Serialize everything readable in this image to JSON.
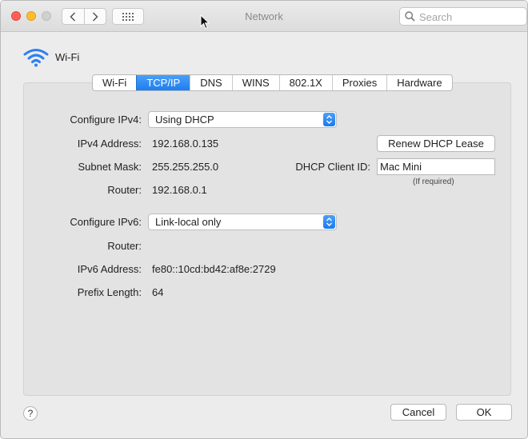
{
  "window": {
    "title": "Network"
  },
  "search": {
    "placeholder": "Search"
  },
  "header": {
    "interface_name": "Wi-Fi"
  },
  "tabs": [
    {
      "label": "Wi-Fi"
    },
    {
      "label": "TCP/IP",
      "active": true
    },
    {
      "label": "DNS"
    },
    {
      "label": "WINS"
    },
    {
      "label": "802.1X"
    },
    {
      "label": "Proxies"
    },
    {
      "label": "Hardware"
    }
  ],
  "ipv4": {
    "configure_label": "Configure IPv4:",
    "configure_value": "Using DHCP",
    "address_label": "IPv4 Address:",
    "address_value": "192.168.0.135",
    "subnet_label": "Subnet Mask:",
    "subnet_value": "255.255.255.0",
    "router_label": "Router:",
    "router_value": "192.168.0.1"
  },
  "dhcp": {
    "renew_label": "Renew DHCP Lease",
    "client_id_label": "DHCP Client ID:",
    "client_id_value": "Mac Mini",
    "client_id_hint": "(If required)"
  },
  "ipv6": {
    "configure_label": "Configure IPv6:",
    "configure_value": "Link-local only",
    "router_label": "Router:",
    "router_value": "",
    "address_label": "IPv6 Address:",
    "address_value": "fe80::10cd:bd42:af8e:2729",
    "prefix_label": "Prefix Length:",
    "prefix_value": "64"
  },
  "footer": {
    "help_label": "?",
    "cancel_label": "Cancel",
    "ok_label": "OK"
  },
  "colors": {
    "accent": "#1d7ef0",
    "close": "#fe5f57",
    "minimize": "#febc2e",
    "maximize_disabled": "#d0d0d0"
  },
  "icons": [
    "back-chevron-icon",
    "forward-chevron-icon",
    "grid-icon",
    "search-icon",
    "wifi-icon",
    "chevron-updown-icon",
    "mouse-pointer-icon"
  ]
}
